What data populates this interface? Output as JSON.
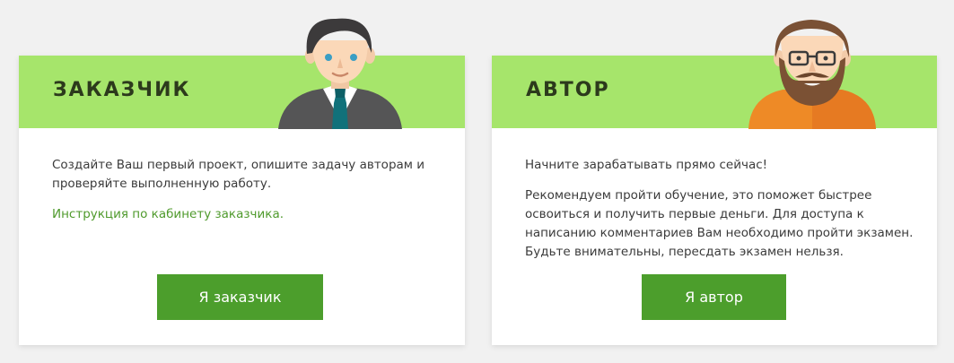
{
  "customer_card": {
    "title": "ЗАКАЗЧИК",
    "description": "Создайте Ваш первый проект, опишите задачу авторам и проверяйте выполненную работу.",
    "link_text": "Инструкция по кабинету заказчика.",
    "button_label": "Я заказчик",
    "avatar_icon": "businessman-avatar-icon"
  },
  "author_card": {
    "title": "АВТОР",
    "paragraph_1": "Начните зарабатывать прямо сейчас!",
    "paragraph_2": "Рекомендуем пройти обучение, это поможет быстрее освоиться и получить первые деньги. Для доступа к написанию комментариев Вам необходимо пройти экзамен. Будьте внимательны, пересдать экзамен нельзя.",
    "button_label": "Я автор",
    "avatar_icon": "bearded-man-avatar-icon"
  },
  "colors": {
    "header_green": "#a6e56b",
    "button_green": "#4c9e2c",
    "link_green": "#4f9a2c",
    "background": "#f1f1f1"
  }
}
